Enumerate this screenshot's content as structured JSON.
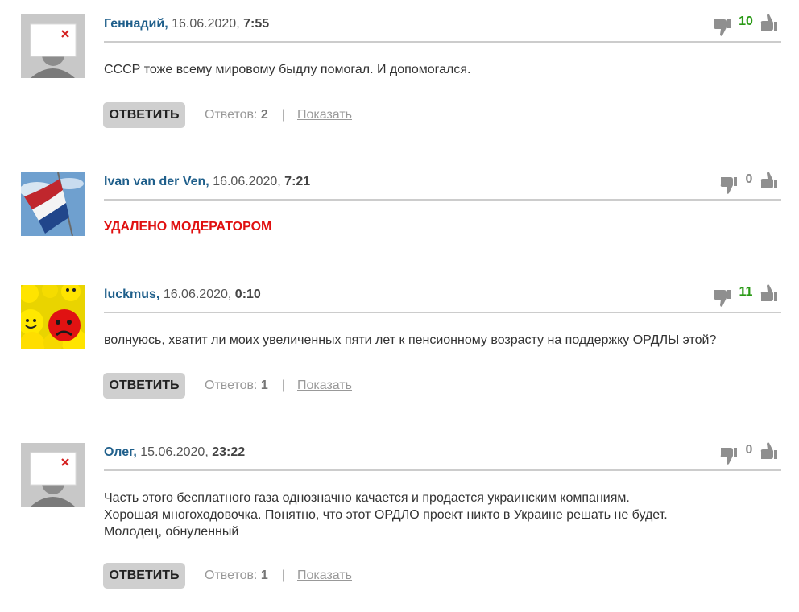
{
  "comments": [
    {
      "avatar": "placeholder-person",
      "author": "Геннадий,",
      "date": "16.06.2020,",
      "time": "7:55",
      "votes": "10",
      "text": "СССР тоже всему мировому быдлу помогал. И допомогался.",
      "reply_label": "ОТВЕТИТЬ",
      "answers_label": "Ответов:",
      "answers_count": "2",
      "separator": "|",
      "show_label": "Показать"
    },
    {
      "avatar": "netherlands-flag",
      "author": "Ivan van der Ven,",
      "date": "16.06.2020,",
      "time": "7:21",
      "votes": "0",
      "deleted_text": "УДАЛЕНО МОДЕРАТОРОМ"
    },
    {
      "avatar": "smileys",
      "author": "luckmus,",
      "date": "16.06.2020,",
      "time": "0:10",
      "votes": "11",
      "text": "волнуюсь, хватит ли моих увеличенных пяти лет к пенсионному возрасту на поддержку ОРДЛЫ этой?",
      "reply_label": "ОТВЕТИТЬ",
      "answers_label": "Ответов:",
      "answers_count": "1",
      "separator": "|",
      "show_label": "Показать"
    },
    {
      "avatar": "placeholder-person",
      "author": "Олег,",
      "date": "15.06.2020,",
      "time": "23:22",
      "votes": "0",
      "text_lines": [
        "Часть этого бесплатного газа однозначно качается и продается украинским компаниям.",
        "Хорошая многоходовочка. Понятно, что этот ОРДЛО проект никто в Украине решать не будет.",
        "Молодец, обнуленный"
      ],
      "reply_label": "ОТВЕТИТЬ",
      "answers_label": "Ответов:",
      "answers_count": "1",
      "separator": "|",
      "show_label": "Показать"
    }
  ],
  "colors": {
    "author": "#1f5f8b",
    "positive_votes": "#2a9a16",
    "deleted": "#e01010",
    "reply_button_bg": "#cfcfcf"
  },
  "icons": [
    "thumbs-down-icon",
    "thumbs-up-icon"
  ]
}
